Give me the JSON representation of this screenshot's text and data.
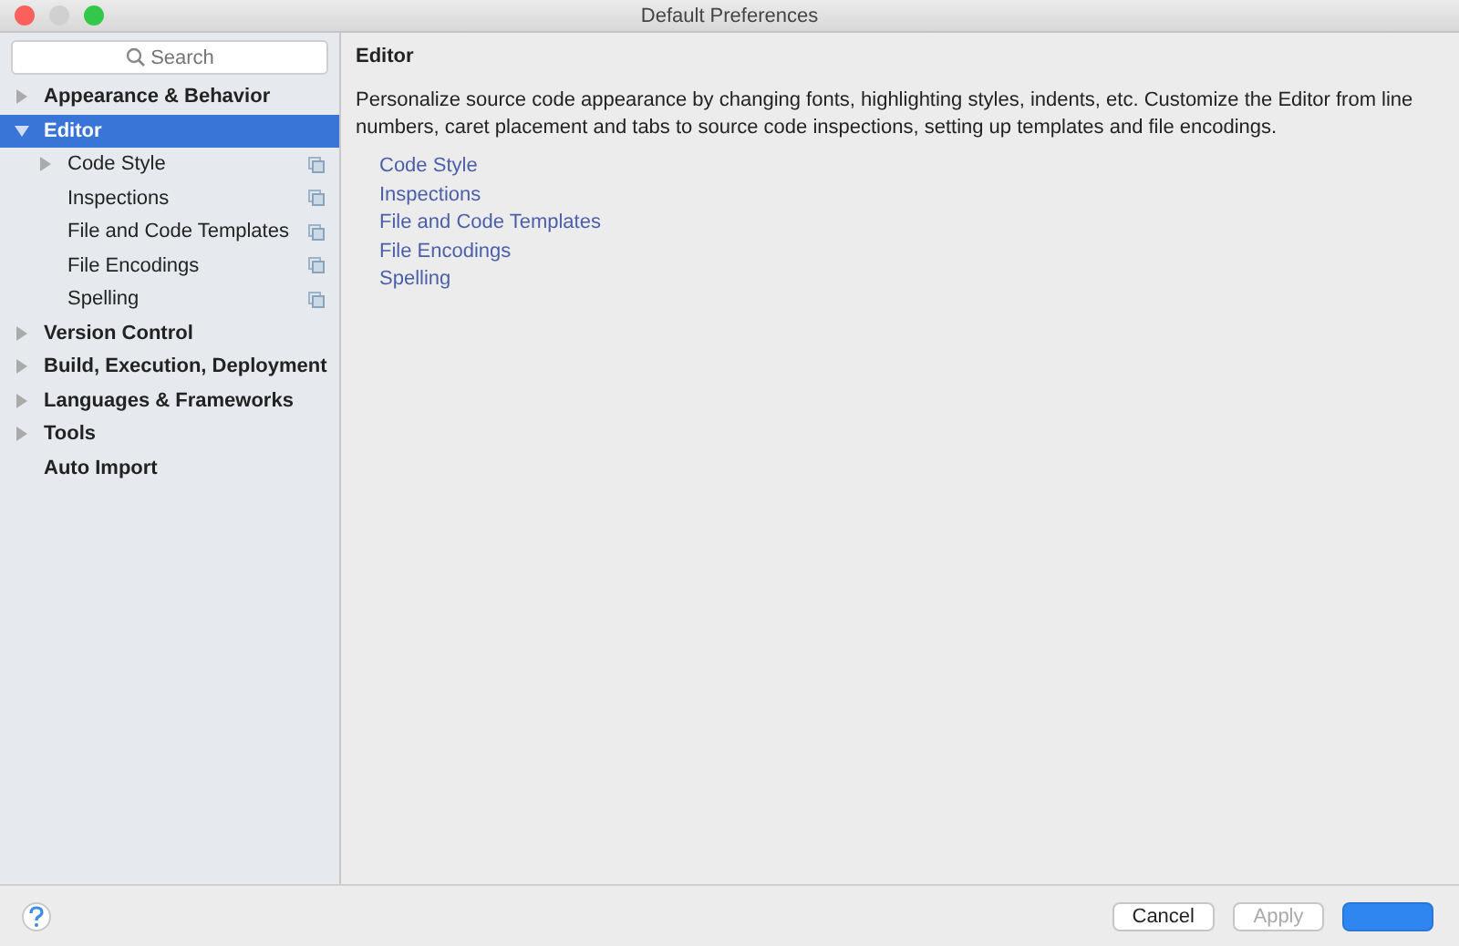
{
  "window": {
    "title": "Default Preferences"
  },
  "search": {
    "placeholder": "Search"
  },
  "sidebar": {
    "items": [
      {
        "label": "Appearance & Behavior",
        "kind": "folder",
        "expanded": false,
        "selected": false,
        "scoped": false
      },
      {
        "label": "Editor",
        "kind": "folder",
        "expanded": true,
        "selected": true,
        "scoped": false,
        "children": [
          {
            "label": "Code Style",
            "kind": "folder",
            "expanded": false,
            "selected": false,
            "scoped": true
          },
          {
            "label": "Inspections",
            "kind": "leaf",
            "selected": false,
            "scoped": true
          },
          {
            "label": "File and Code Templates",
            "kind": "leaf",
            "selected": false,
            "scoped": true
          },
          {
            "label": "File Encodings",
            "kind": "leaf",
            "selected": false,
            "scoped": true
          },
          {
            "label": "Spelling",
            "kind": "leaf",
            "selected": false,
            "scoped": true
          }
        ]
      },
      {
        "label": "Version Control",
        "kind": "folder",
        "expanded": false,
        "selected": false,
        "scoped": false
      },
      {
        "label": "Build, Execution, Deployment",
        "kind": "folder",
        "expanded": false,
        "selected": false,
        "scoped": false
      },
      {
        "label": "Languages & Frameworks",
        "kind": "folder",
        "expanded": false,
        "selected": false,
        "scoped": false
      },
      {
        "label": "Tools",
        "kind": "folder",
        "expanded": false,
        "selected": false,
        "scoped": false
      },
      {
        "label": "Auto Import",
        "kind": "leaf",
        "selected": false,
        "scoped": false
      }
    ]
  },
  "content": {
    "title": "Editor",
    "description": "Personalize source code appearance by changing fonts, highlighting styles, indents, etc. Customize the Editor from line numbers, caret placement and tabs to source code inspections, setting up templates and file encodings.",
    "links": [
      "Code Style",
      "Inspections",
      "File and Code Templates",
      "File Encodings",
      "Spelling"
    ]
  },
  "buttons": [
    {
      "label": "Cancel",
      "kind": "normal",
      "disabled": false
    },
    {
      "label": "Apply",
      "kind": "normal",
      "disabled": true
    },
    {
      "kind": "default",
      "disabled": false
    }
  ]
}
